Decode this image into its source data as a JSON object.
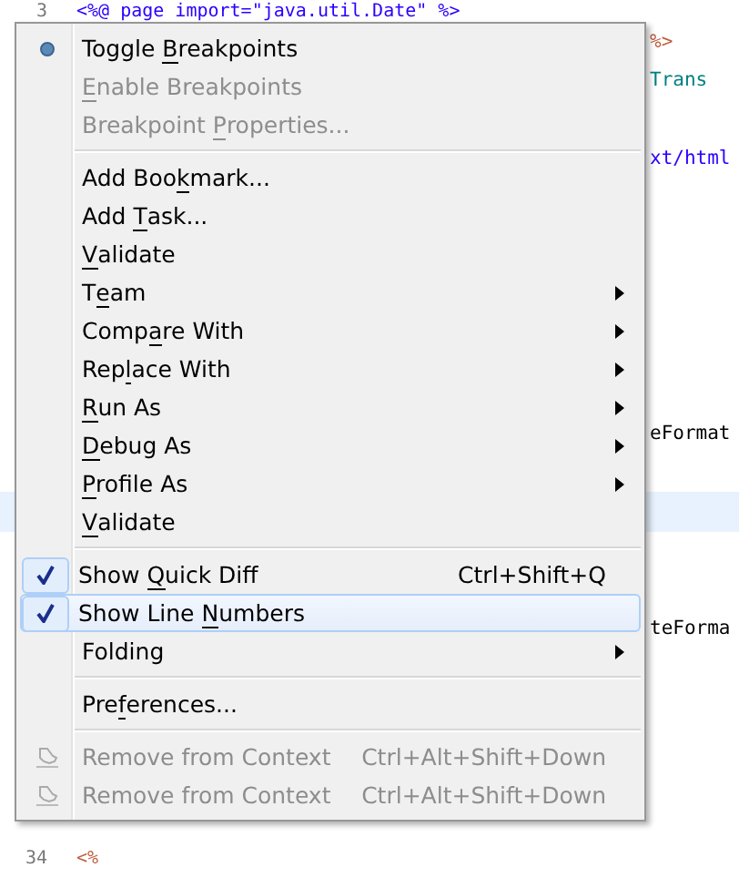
{
  "editor": {
    "lines": [
      {
        "number": "3",
        "code": "<%@ page import=\"java.util.Date\" %>",
        "color": "#2a00ff"
      },
      {
        "number": "34",
        "code": "<%",
        "color": "#bf5f3f"
      }
    ],
    "fragments": [
      {
        "code": "%>",
        "color": "#bf5f3f"
      },
      {
        "code": "Trans",
        "color": "#008080"
      },
      {
        "code": "xt/html",
        "color": "#2a00ff"
      },
      {
        "code": "eFormat",
        "color": "#000000"
      },
      {
        "code": "teForma",
        "color": "#000000"
      }
    ],
    "current_line": true
  },
  "menu": [
    {
      "kind": "breakpoint",
      "label": [
        {
          "text": "Toggle ",
          "mnemonic": false
        },
        {
          "text": "B",
          "mnemonic": true
        },
        {
          "text": "reakpoints",
          "mnemonic": false
        }
      ],
      "disabled": false,
      "selected": false
    },
    {
      "kind": "plain",
      "label": [
        {
          "text": "E",
          "mnemonic": true
        },
        {
          "text": "nable Breakpoints",
          "mnemonic": false
        }
      ],
      "disabled": true,
      "selected": false
    },
    {
      "kind": "plain",
      "label": [
        {
          "text": "Breakpoint ",
          "mnemonic": false
        },
        {
          "text": "P",
          "mnemonic": true
        },
        {
          "text": "roperties...",
          "mnemonic": false
        }
      ],
      "disabled": true,
      "selected": false
    },
    {
      "kind": "separator"
    },
    {
      "kind": "plain",
      "label": [
        {
          "text": "Add Boo",
          "mnemonic": false
        },
        {
          "text": "k",
          "mnemonic": true
        },
        {
          "text": "mark...",
          "mnemonic": false
        }
      ],
      "disabled": false,
      "selected": false
    },
    {
      "kind": "plain",
      "label": [
        {
          "text": "Add ",
          "mnemonic": false
        },
        {
          "text": "T",
          "mnemonic": true
        },
        {
          "text": "ask...",
          "mnemonic": false
        }
      ],
      "disabled": false,
      "selected": false
    },
    {
      "kind": "plain",
      "label": [
        {
          "text": "V",
          "mnemonic": true
        },
        {
          "text": "alidate",
          "mnemonic": false
        }
      ],
      "disabled": false,
      "selected": false
    },
    {
      "kind": "plain",
      "label": [
        {
          "text": "T",
          "mnemonic": false
        },
        {
          "text": "e",
          "mnemonic": true
        },
        {
          "text": "am",
          "mnemonic": false
        }
      ],
      "disabled": false,
      "selected": false,
      "submenu": true
    },
    {
      "kind": "plain",
      "label": [
        {
          "text": "Comp",
          "mnemonic": false
        },
        {
          "text": "a",
          "mnemonic": true
        },
        {
          "text": "re With",
          "mnemonic": false
        }
      ],
      "disabled": false,
      "selected": false,
      "submenu": true
    },
    {
      "kind": "plain",
      "label": [
        {
          "text": "Rep",
          "mnemonic": false
        },
        {
          "text": "l",
          "mnemonic": true
        },
        {
          "text": "ace With",
          "mnemonic": false
        }
      ],
      "disabled": false,
      "selected": false,
      "submenu": true
    },
    {
      "kind": "plain",
      "label": [
        {
          "text": "R",
          "mnemonic": true
        },
        {
          "text": "un As",
          "mnemonic": false
        }
      ],
      "disabled": false,
      "selected": false,
      "submenu": true
    },
    {
      "kind": "plain",
      "label": [
        {
          "text": "D",
          "mnemonic": true
        },
        {
          "text": "ebug As",
          "mnemonic": false
        }
      ],
      "disabled": false,
      "selected": false,
      "submenu": true
    },
    {
      "kind": "plain",
      "label": [
        {
          "text": "P",
          "mnemonic": true
        },
        {
          "text": "rofile As",
          "mnemonic": false
        }
      ],
      "disabled": false,
      "selected": false,
      "submenu": true
    },
    {
      "kind": "plain",
      "label": [
        {
          "text": "V",
          "mnemonic": true
        },
        {
          "text": "alidate",
          "mnemonic": false
        }
      ],
      "disabled": false,
      "selected": false
    },
    {
      "kind": "separator"
    },
    {
      "kind": "check",
      "label": [
        {
          "text": "Show ",
          "mnemonic": false
        },
        {
          "text": "Q",
          "mnemonic": true
        },
        {
          "text": "uick Diff",
          "mnemonic": false
        }
      ],
      "shortcut": "Ctrl+Shift+Q",
      "checked": true,
      "disabled": false,
      "selected": false
    },
    {
      "kind": "check",
      "label": [
        {
          "text": "Show Line ",
          "mnemonic": false
        },
        {
          "text": "N",
          "mnemonic": true
        },
        {
          "text": "umbers",
          "mnemonic": false
        }
      ],
      "checked": true,
      "disabled": false,
      "selected": true
    },
    {
      "kind": "plain",
      "label": [
        {
          "text": "Folding",
          "mnemonic": false
        }
      ],
      "disabled": false,
      "selected": false,
      "submenu": true
    },
    {
      "kind": "separator"
    },
    {
      "kind": "plain",
      "label": [
        {
          "text": "Pre",
          "mnemonic": false
        },
        {
          "text": "f",
          "mnemonic": true
        },
        {
          "text": "erences...",
          "mnemonic": false
        }
      ],
      "disabled": false,
      "selected": false
    },
    {
      "kind": "separator"
    },
    {
      "kind": "context",
      "label": [
        {
          "text": "Remove from Context",
          "mnemonic": false
        }
      ],
      "shortcut": "Ctrl+Alt+Shift+Down",
      "disabled": true,
      "selected": false
    },
    {
      "kind": "context",
      "label": [
        {
          "text": "Remove from Context",
          "mnemonic": false
        }
      ],
      "shortcut": "Ctrl+Alt+Shift+Down",
      "disabled": true,
      "selected": false
    }
  ]
}
